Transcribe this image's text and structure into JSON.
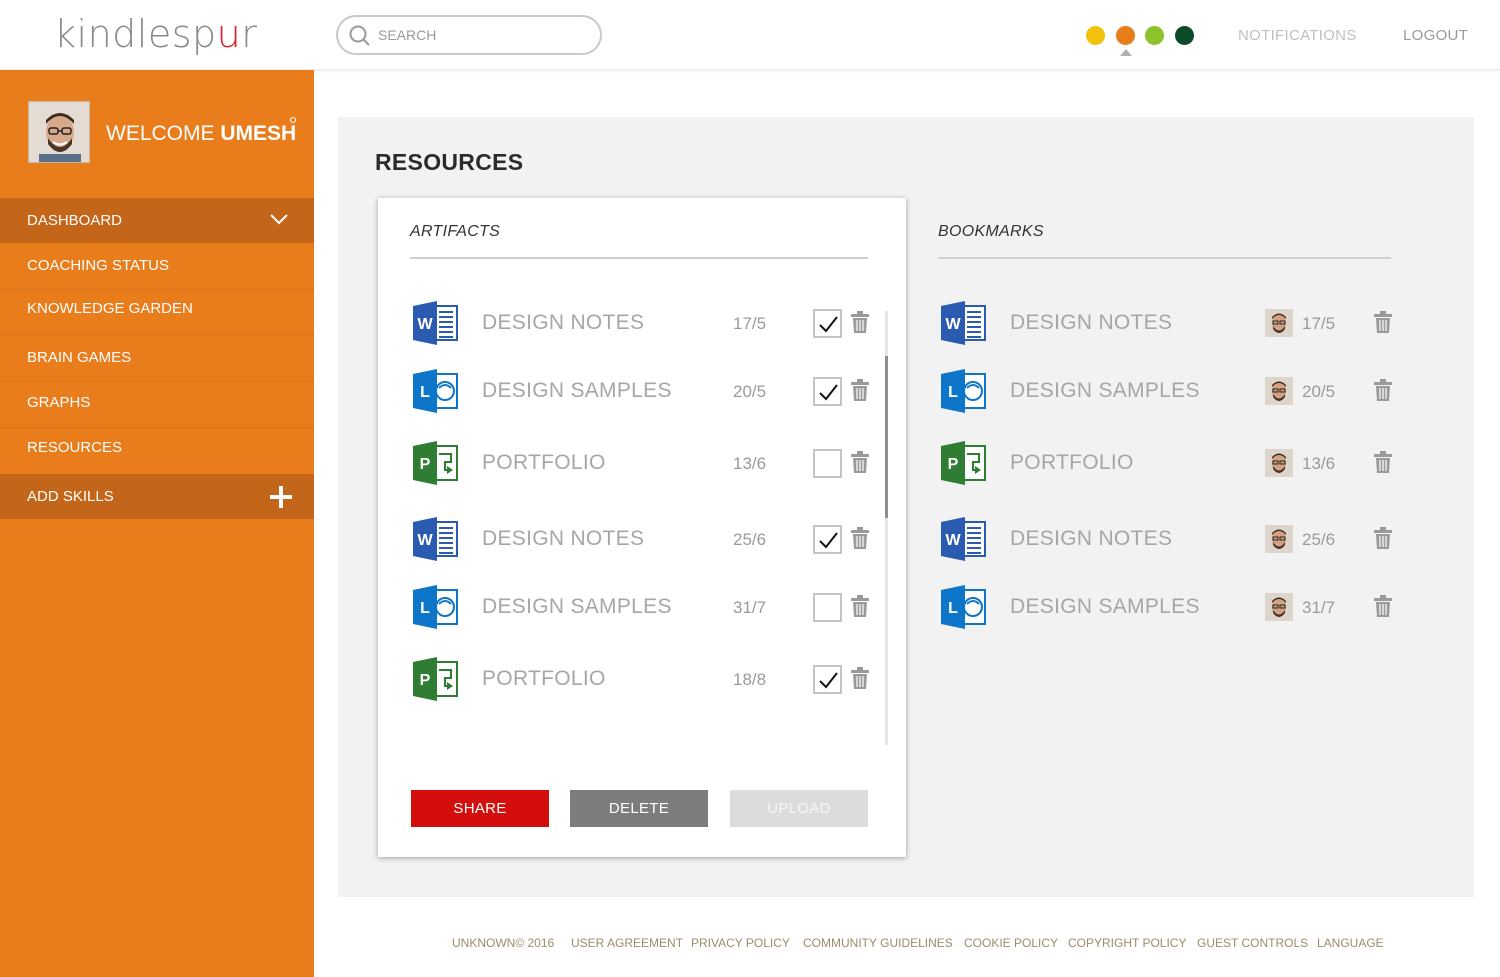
{
  "header": {
    "logo_prefix": "kindlesp",
    "logo_u": "u",
    "logo_suffix": "r",
    "search_placeholder": "SEARCH",
    "theme_colors": [
      "#f2c10c",
      "#e97d1c",
      "#8cc22b",
      "#0d4a2a"
    ],
    "notifications_label": "NOTIFICATIONS",
    "logout_label": "LOGOUT"
  },
  "sidebar": {
    "welcome_prefix": "WELCOME",
    "user_name": "UMESH",
    "items": [
      {
        "label": "DASHBOARD",
        "active": true,
        "icon": "chevron-down-icon"
      },
      {
        "label": "COACHING STATUS"
      },
      {
        "label": "KNOWLEDGE GARDEN"
      },
      {
        "label": "BRAIN GAMES"
      },
      {
        "label": "GRAPHS"
      },
      {
        "label": "RESOURCES"
      },
      {
        "label": "ADD SKILLS",
        "active": true,
        "icon": "plus-icon"
      }
    ]
  },
  "main": {
    "title": "RESOURCES",
    "artifacts": {
      "title": "ARTIFACTS",
      "rows": [
        {
          "name": "DESIGN NOTES",
          "date": "17/5",
          "icon": "word-doc-icon",
          "checked": true
        },
        {
          "name": "DESIGN SAMPLES",
          "date": "20/5",
          "icon": "lync-doc-icon",
          "checked": true
        },
        {
          "name": "PORTFOLIO",
          "date": "13/6",
          "icon": "project-doc-icon",
          "checked": false
        },
        {
          "name": "DESIGN NOTES",
          "date": "25/6",
          "icon": "word-doc-icon",
          "checked": true
        },
        {
          "name": "DESIGN SAMPLES",
          "date": "31/7",
          "icon": "lync-doc-icon",
          "checked": false
        },
        {
          "name": "PORTFOLIO",
          "date": "18/8",
          "icon": "project-doc-icon",
          "checked": true
        }
      ],
      "buttons": {
        "share": "SHARE",
        "delete": "DELETE",
        "upload": "UPLOAD"
      }
    },
    "bookmarks": {
      "title": "BOOKMARKS",
      "rows": [
        {
          "name": "DESIGN NOTES",
          "date": "17/5",
          "icon": "word-doc-icon"
        },
        {
          "name": "DESIGN SAMPLES",
          "date": "20/5",
          "icon": "lync-doc-icon"
        },
        {
          "name": "PORTFOLIO",
          "date": "13/6",
          "icon": "project-doc-icon"
        },
        {
          "name": "DESIGN NOTES",
          "date": "25/6",
          "icon": "word-doc-icon"
        },
        {
          "name": "DESIGN SAMPLES",
          "date": "31/7",
          "icon": "lync-doc-icon"
        }
      ]
    }
  },
  "footer": {
    "links": [
      "UNKNOWN© 2016",
      "USER AGREEMENT",
      "PRIVACY POLICY",
      "COMMUNITY GUIDELINES",
      "COOKIE POLICY",
      "COPYRIGHT POLICY",
      "GUEST CONTROLS",
      "LANGUAGE"
    ]
  }
}
